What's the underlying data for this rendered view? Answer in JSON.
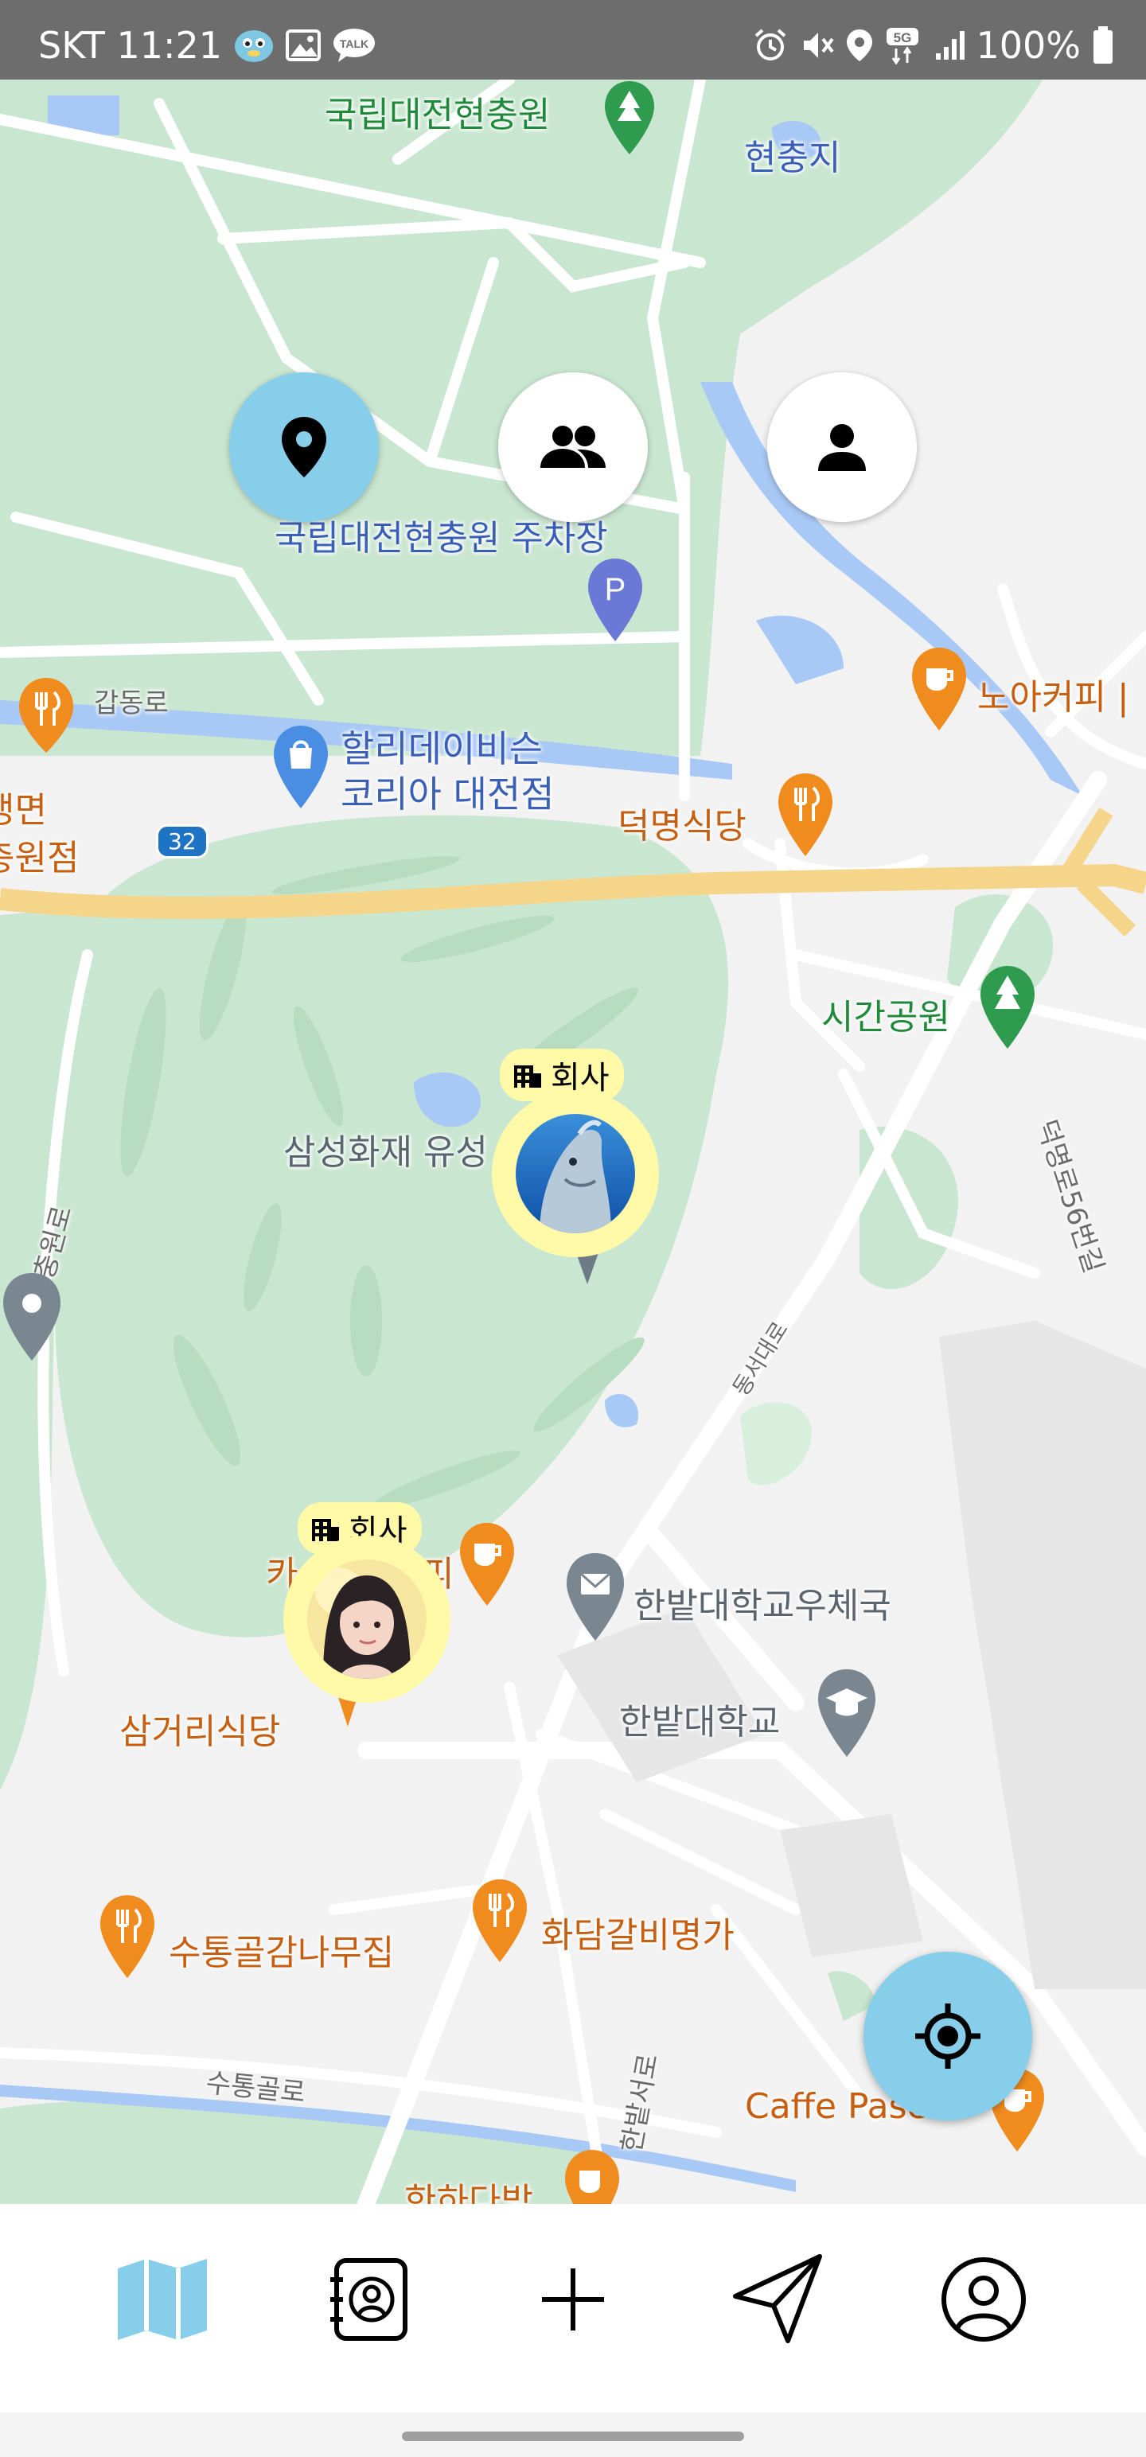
{
  "status_bar": {
    "carrier_time": "SKT 11:21",
    "battery": "100%",
    "network": "5G",
    "left_icons": [
      "kids-app-icon",
      "gallery-icon",
      "talk-icon"
    ],
    "talk_badge": "TALK",
    "right_icons": [
      "alarm-icon",
      "vibrate-off-icon",
      "location-icon",
      "5g-icon",
      "signal-icon",
      "battery-icon"
    ]
  },
  "map": {
    "labels": {
      "cemetery": "국립대전현충원",
      "hyunchungji": "현충지",
      "parking": "국립대전현충원 주차장",
      "gapdong_ro": "갑동로",
      "holiday_inn_1": "할리데이비슨",
      "holiday_inn_2": "코리아 대전점",
      "naengmyeon_1": "냉면",
      "naengmyeon_2": "충원점",
      "deokmyeong": "덕명식당",
      "noa_coffee": "노아커피 |",
      "sigan_park": "시간공원",
      "samsung": "삼성화재 유성",
      "hyeonchung_ro": "현충원로",
      "deokmyeong_ro": "덕명로56번길",
      "dongseo_daero": "동서대로",
      "post_office": "한밭대학교우체국",
      "hanbat_univ": "한밭대학교",
      "samgeori": "삼거리식당",
      "cafe_partial": "카",
      "cafe_partial_2": "피",
      "sutong_restaurant": "수통골감나무집",
      "hwadam": "화담갈비명가",
      "sutong_ro": "수통골로",
      "hanbat_seoro": "한밭서로",
      "caffe_paseo": "Caffe Paseo",
      "hanha_dabang": "한하다방",
      "route_32": "32"
    },
    "friends": [
      {
        "tag": "회사",
        "avatar": "dolphin"
      },
      {
        "tag": "회사",
        "avatar": "girl-photo"
      }
    ],
    "colors": {
      "park": "#c9e6d0",
      "water": "#a8c8f5",
      "road": "#ffffff",
      "highway": "#f5d58a",
      "active_button": "#87ceeb",
      "friend_ring": "#fff9a8"
    }
  },
  "mode_buttons": [
    {
      "name": "place-mode",
      "icon": "place-icon",
      "active": true
    },
    {
      "name": "group-mode",
      "icon": "group-icon",
      "active": false
    },
    {
      "name": "person-mode",
      "icon": "person-icon",
      "active": false
    }
  ],
  "nav": {
    "items": [
      {
        "name": "map",
        "icon": "map-icon",
        "active": true
      },
      {
        "name": "contacts",
        "icon": "contacts-icon",
        "active": false
      },
      {
        "name": "add",
        "icon": "plus-icon",
        "active": false
      },
      {
        "name": "send",
        "icon": "send-icon",
        "active": false
      },
      {
        "name": "profile",
        "icon": "profile-icon",
        "active": false
      }
    ]
  }
}
